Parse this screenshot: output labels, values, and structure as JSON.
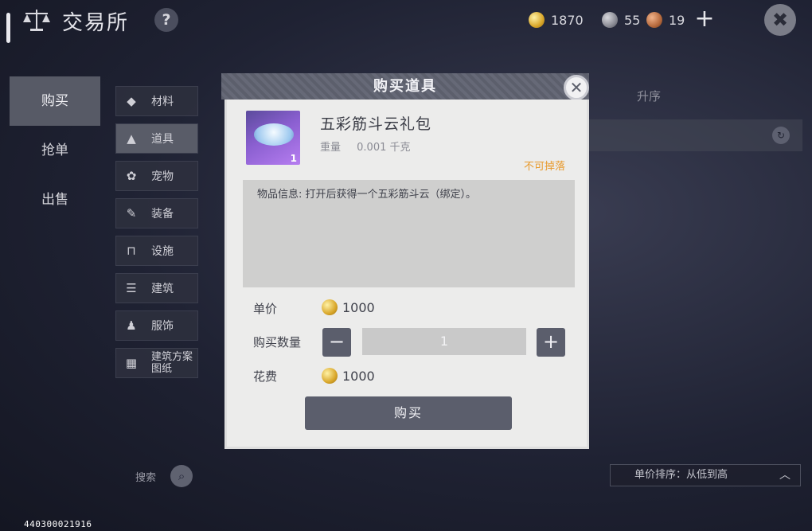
{
  "header": {
    "title": "交易所",
    "help_label": "?",
    "currencies": [
      {
        "icon": "gold-coin-icon",
        "value": "1870"
      },
      {
        "icon": "silver-coin-icon",
        "value": "55"
      },
      {
        "icon": "copper-coin-icon",
        "value": "19"
      }
    ],
    "add_label": "+"
  },
  "nav": {
    "items": [
      {
        "label": "购买",
        "active": true
      },
      {
        "label": "抢单",
        "active": false
      },
      {
        "label": "出售",
        "active": false
      }
    ]
  },
  "categories": [
    {
      "label": "材料",
      "icon": "material-icon"
    },
    {
      "label": "道具",
      "icon": "potion-icon",
      "active": true
    },
    {
      "label": "宠物",
      "icon": "paw-icon"
    },
    {
      "label": "装备",
      "icon": "equipment-icon"
    },
    {
      "label": "设施",
      "icon": "facility-icon"
    },
    {
      "label": "建筑",
      "icon": "building-icon"
    },
    {
      "label": "服饰",
      "icon": "clothing-icon"
    },
    {
      "label": "建筑方案图纸",
      "icon": "blueprint-icon"
    }
  ],
  "background": {
    "tab_right": "升序",
    "search_label": "搜索",
    "sort_label": "单价排序：从低到高"
  },
  "modal": {
    "title": "购买道具",
    "item": {
      "name": "五彩筋斗云礼包",
      "weight_label": "重量",
      "weight_value": "0.001 千克",
      "drop_status": "不可掉落",
      "count": "1",
      "info": "物品信息: 打开后获得一个五彩筋斗云（绑定）。"
    },
    "unit_price_label": "单价",
    "unit_price": "1000",
    "quantity_label": "购买数量",
    "quantity": "1",
    "minus_label": "−",
    "plus_label": "+",
    "cost_label": "花费",
    "cost": "1000",
    "buy_label": "购买"
  },
  "footer": {
    "id": "440300021916"
  },
  "colors": {
    "accent_orange": "#e89a2c",
    "button_dark": "#5b5e6c",
    "modal_bg": "#ececeb"
  }
}
